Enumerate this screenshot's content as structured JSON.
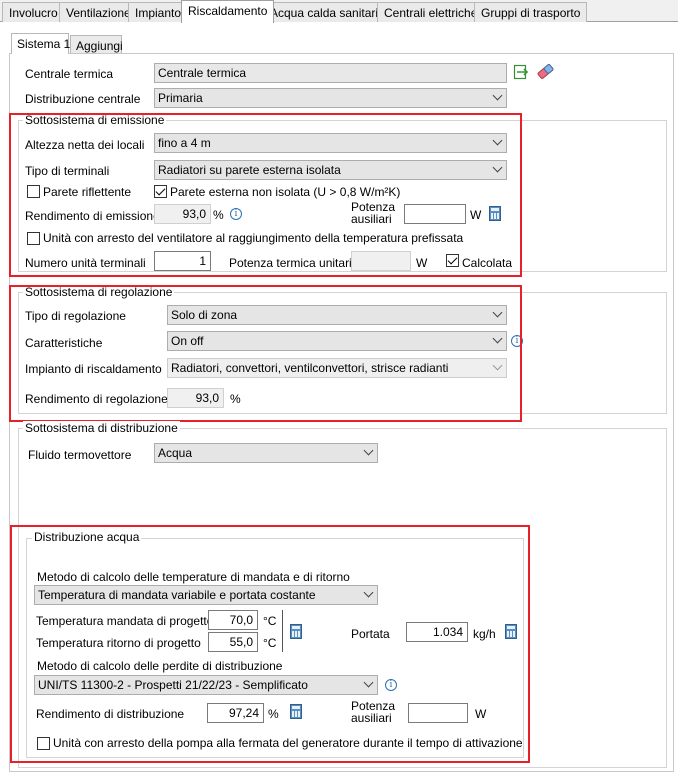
{
  "tabs": [
    "Involucro",
    "Ventilazione",
    "Impianto",
    "Riscaldamento",
    "Acqua calda sanitaria",
    "Centrali elettriche",
    "Gruppi di trasporto"
  ],
  "active_tab": "Riscaldamento",
  "subtabs": [
    "Sistema 1",
    "Aggiungi"
  ],
  "top": {
    "centrale_label": "Centrale termica",
    "centrale_value": "Centrale termica",
    "distribuzione_label": "Distribuzione centrale",
    "distribuzione_value": "Primaria"
  },
  "emissione": {
    "title": "Sottosistema di emissione",
    "altezza_label": "Altezza netta dei locali",
    "altezza_value": "fino a 4 m",
    "terminali_label": "Tipo di terminali",
    "terminali_value": "Radiatori su parete esterna isolata",
    "parete_riflettente": "Parete riflettente",
    "parete_riflettente_checked": false,
    "parete_non_isolata": "Parete esterna non isolata (U > 0,8 W/m²K)",
    "parete_non_isolata_checked": true,
    "rendimento_label": "Rendimento di emissione",
    "rendimento_value": "93,0",
    "rendimento_unit": "%",
    "potenza_aux_label1": "Potenza",
    "potenza_aux_label2": "ausiliari",
    "potenza_aux_value": "",
    "potenza_aux_unit": "W",
    "ventilatore_label": "Unità con arresto del ventilatore al raggiungimento della temperatura prefissata",
    "ventilatore_checked": false,
    "num_unita_label": "Numero unità terminali",
    "num_unita_value": "1",
    "potenza_unitaria_label": "Potenza termica unitaria",
    "potenza_unitaria_value": "",
    "potenza_unitaria_unit": "W",
    "calcolata_label": "Calcolata",
    "calcolata_checked": true
  },
  "regolazione": {
    "title": "Sottosistema di regolazione",
    "tipo_label": "Tipo di regolazione",
    "tipo_value": "Solo di zona",
    "caratteristiche_label": "Caratteristiche",
    "caratteristiche_value": "On off",
    "impianto_label": "Impianto di riscaldamento",
    "impianto_value": "Radiatori, convettori, ventilconvettori, strisce radianti",
    "rendimento_label": "Rendimento di regolazione",
    "rendimento_value": "93,0",
    "rendimento_unit": "%"
  },
  "distribuzione": {
    "title": "Sottosistema di distribuzione",
    "fluido_label": "Fluido termovettore",
    "fluido_value": "Acqua"
  },
  "acqua": {
    "title": "Distribuzione acqua",
    "metodo_temp_label": "Metodo di calcolo delle temperature di mandata e di ritorno",
    "metodo_temp_value": "Temperatura di mandata variabile e portata costante",
    "t_mandata_label": "Temperatura mandata di progetto",
    "t_mandata_value": "70,0",
    "t_mandata_unit": "°C",
    "t_ritorno_label": "Temperatura ritorno di progetto",
    "t_ritorno_value": "55,0",
    "t_ritorno_unit": "°C",
    "portata_label": "Portata",
    "portata_value": "1.034",
    "portata_unit": "kg/h",
    "metodo_perdite_label": "Metodo di calcolo delle perdite di distribuzione",
    "metodo_perdite_value": "UNI/TS 11300-2 - Prospetti 21/22/23 - Semplificato",
    "rendimento_label": "Rendimento di distribuzione",
    "rendimento_value": "97,24",
    "rendimento_unit": "%",
    "potenza_aux_label1": "Potenza",
    "potenza_aux_label2": "ausiliari",
    "potenza_aux_value": "",
    "potenza_aux_unit": "W",
    "pompa_label": "Unità con arresto della pompa alla fermata del generatore durante il tempo di attivazione",
    "pompa_checked": false
  },
  "colors": {
    "highlight": "#e8202a",
    "info": "#2d6fb5",
    "calc": "#5b8ec0"
  }
}
